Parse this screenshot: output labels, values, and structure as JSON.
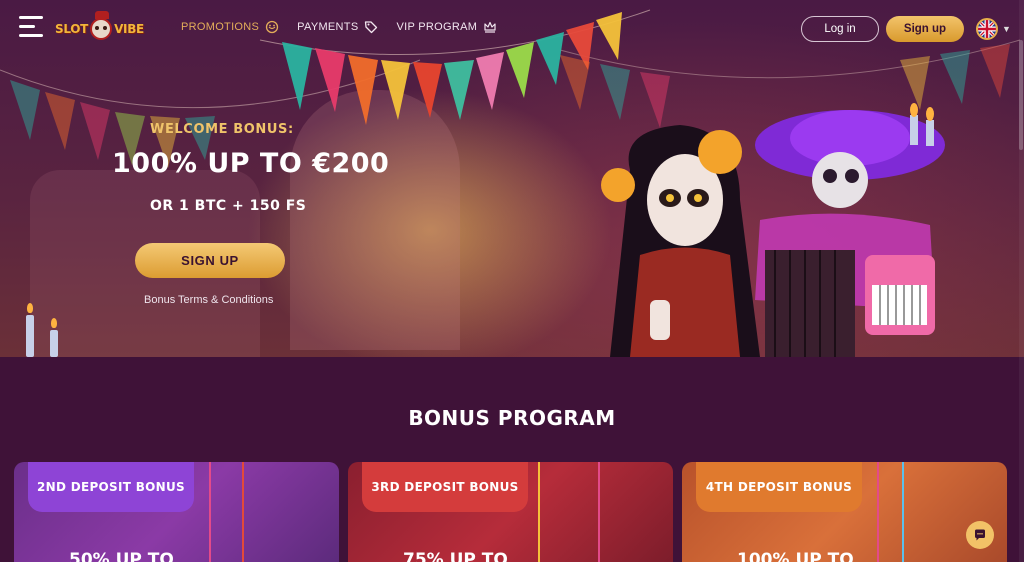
{
  "header": {
    "logo_text_left": "SLOT",
    "logo_text_right": "VIBE",
    "nav": [
      {
        "label": "PROMOTIONS",
        "icon": "chili-icon",
        "active": true
      },
      {
        "label": "PAYMENTS",
        "icon": "tag-icon",
        "active": false
      },
      {
        "label": "VIP PROGRAM",
        "icon": "crown-icon",
        "active": false
      }
    ],
    "login_label": "Log in",
    "signup_label": "Sign up",
    "language_icon": "uk-flag-icon"
  },
  "hero": {
    "welcome": "WELCOME BONUS:",
    "main": "100% UP TO €200",
    "sub": "OR 1 BTC + 150 FS",
    "cta": "SIGN UP",
    "terms": "Bonus Terms & Conditions"
  },
  "bonus_program": {
    "title": "BONUS PROGRAM",
    "cards": [
      {
        "tag": "2ND DEPOSIT BONUS",
        "value": "50% UP TO"
      },
      {
        "tag": "3RD DEPOSIT BONUS",
        "value": "75% UP TO"
      },
      {
        "tag": "4TH DEPOSIT BONUS",
        "value": "100% UP TO"
      }
    ]
  },
  "colors": {
    "background": "#3f1238",
    "accent_gold": "#e3ad5a",
    "card_purple": "#8e44d6",
    "card_red": "#d43c3c",
    "card_orange": "#e07a2e"
  }
}
